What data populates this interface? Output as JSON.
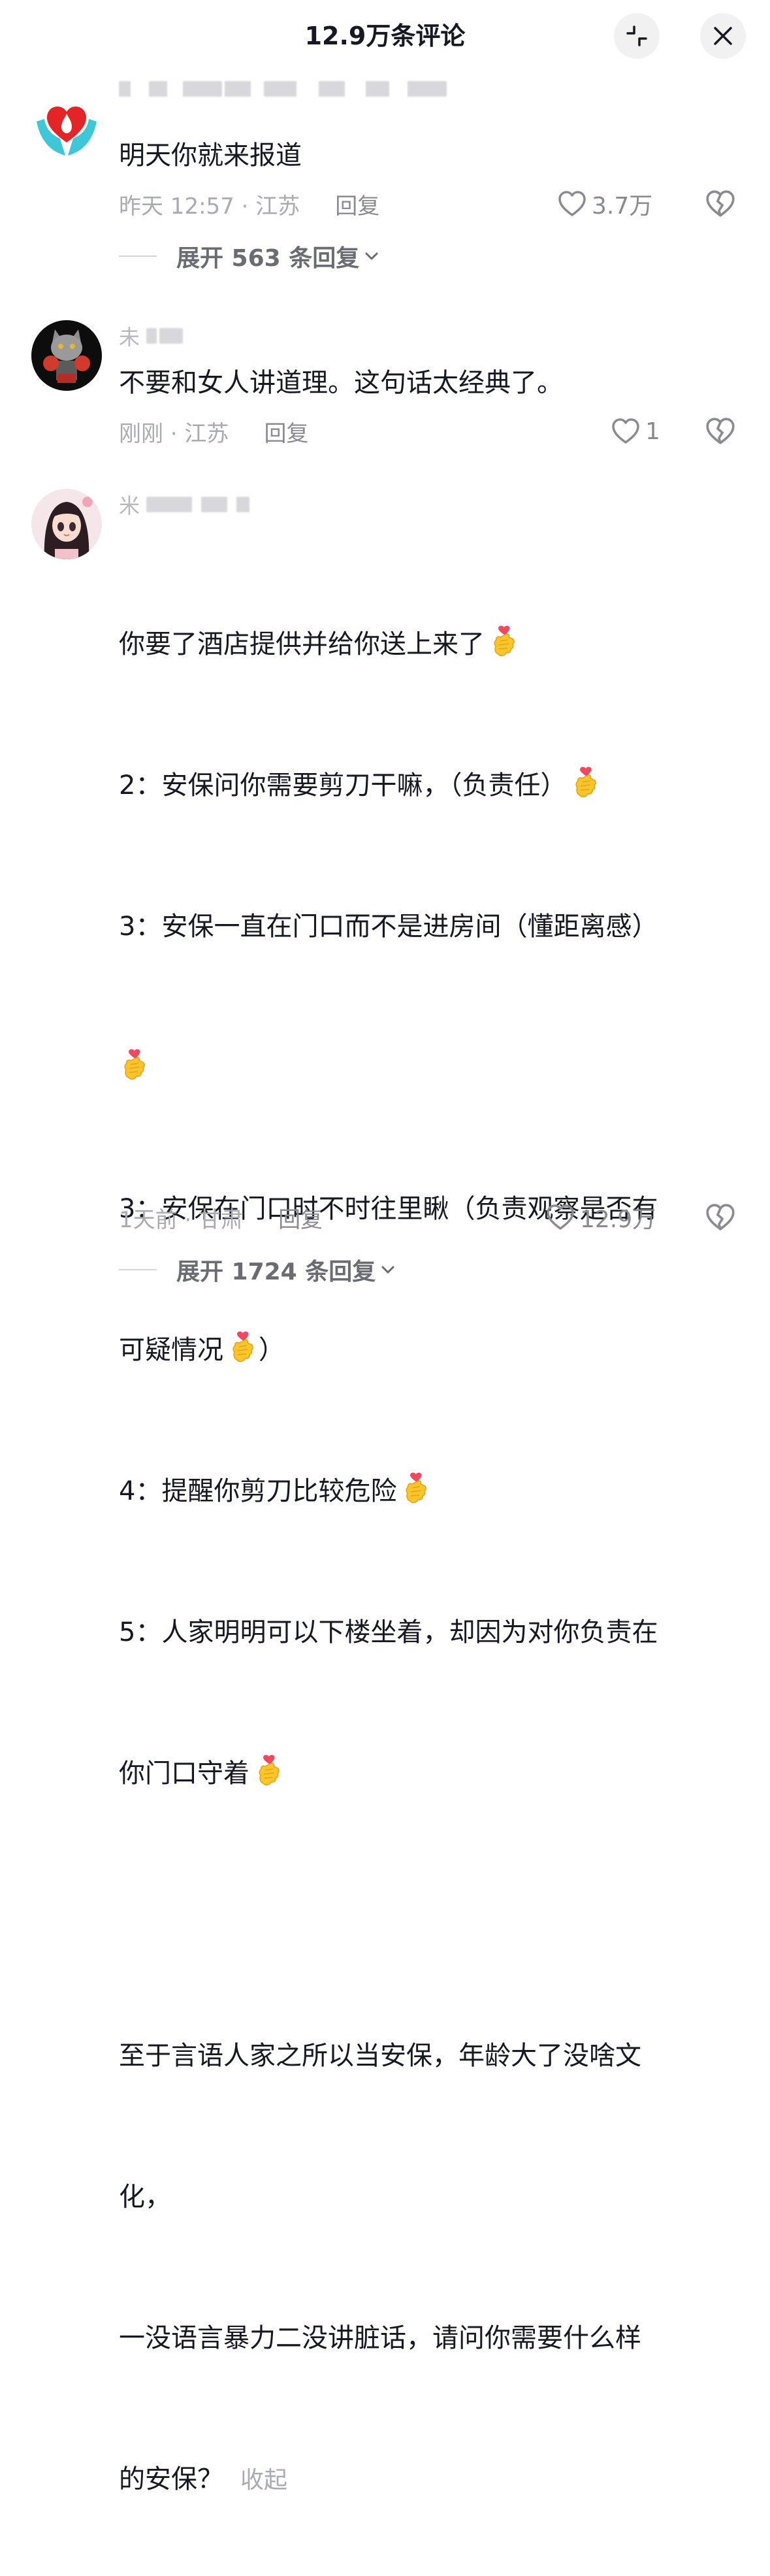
{
  "header": {
    "title": "12.9万条评论",
    "collapse_icon": "collapse-arrows-icon",
    "close_icon": "close-icon"
  },
  "comments": [
    {
      "text": "明天你就来报道",
      "time_location": "昨天 12:57 · 江苏",
      "reply_label": "回复",
      "likes": "3.7万",
      "expand_label": "展开 563 条回复"
    },
    {
      "username": "未",
      "text": "不要和女人讲道理。这句话太经典了。",
      "time_location": "刚刚 · 江苏",
      "reply_label": "回复",
      "likes": "1"
    },
    {
      "username": "米",
      "lines": [
        "你要了酒店提供并给你送上来了",
        "2：安保问你需要剪刀干嘛，（负责任）",
        "3：安保一直在门口而不是进房间（懂距离感）",
        "3：安保在门口时不时往里瞅（负责观察是否有",
        "可疑情况",
        "）",
        "4：提醒你剪刀比较危险",
        "5：人家明明可以下楼坐着，却因为对你负责在",
        "你门口守着",
        "至于言语人家之所以当安保，年龄大了没啥文",
        "化，",
        "一没语言暴力二没讲脏话，请问你需要什么样",
        "的安保？"
      ],
      "collapse_label": "收起",
      "time_location": "1天前 · 甘肃",
      "reply_label": "回复",
      "likes": "12.9万",
      "expand_label": "展开 1724 条回复"
    }
  ],
  "icons": {
    "like": "heart-outline-icon",
    "dislike": "broken-heart-icon",
    "emoji": "finger-heart-emoji-icon",
    "chevron": "chevron-down-icon"
  }
}
